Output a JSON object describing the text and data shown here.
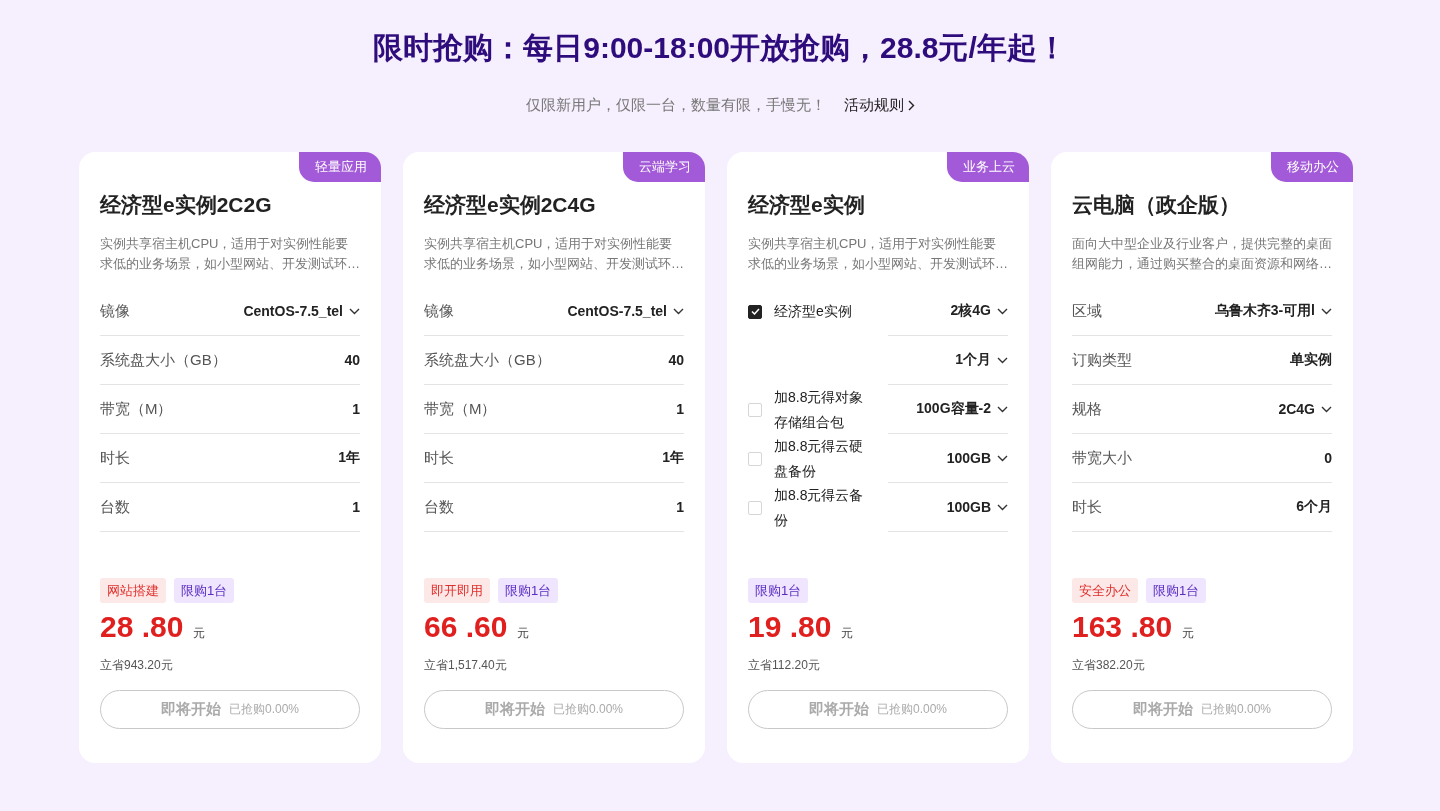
{
  "header": {
    "title": "限时抢购：每日9:00-18:00开放抢购，28.8元/年起！",
    "subtitle": "仅限新用户，仅限一台，数量有限，手慢无！",
    "rules_link": "活动规则"
  },
  "cards": [
    {
      "badge": "轻量应用",
      "title": "经济型e实例2C2G",
      "description": "实例共享宿主机CPU，适用于对实例性能要求低的业务场景，如小型网站、开发测试环…",
      "rows": [
        {
          "kind": "field",
          "label": "镜像",
          "value": "CentOS-7.5_tel",
          "dropdown": true
        },
        {
          "kind": "field",
          "label": "系统盘大小（GB）",
          "value": "40",
          "dropdown": false
        },
        {
          "kind": "field",
          "label": "带宽（M）",
          "value": "1",
          "dropdown": false
        },
        {
          "kind": "field",
          "label": "时长",
          "value": "1年",
          "dropdown": false
        },
        {
          "kind": "field",
          "label": "台数",
          "value": "1",
          "dropdown": false
        }
      ],
      "tags": [
        {
          "kind": "feature",
          "text": "网站搭建"
        },
        {
          "kind": "limit",
          "text": "限购1台"
        }
      ],
      "price": "28 .80",
      "currency": "元",
      "savings": "立省943.20元",
      "button": {
        "label": "即将开始",
        "progress": "已抢购0.00%",
        "disabled": true
      }
    },
    {
      "badge": "云端学习",
      "title": "经济型e实例2C4G",
      "description": "实例共享宿主机CPU，适用于对实例性能要求低的业务场景，如小型网站、开发测试环…",
      "rows": [
        {
          "kind": "field",
          "label": "镜像",
          "value": "CentOS-7.5_tel",
          "dropdown": true
        },
        {
          "kind": "field",
          "label": "系统盘大小（GB）",
          "value": "40",
          "dropdown": false
        },
        {
          "kind": "field",
          "label": "带宽（M）",
          "value": "1",
          "dropdown": false
        },
        {
          "kind": "field",
          "label": "时长",
          "value": "1年",
          "dropdown": false
        },
        {
          "kind": "field",
          "label": "台数",
          "value": "1",
          "dropdown": false
        }
      ],
      "tags": [
        {
          "kind": "feature",
          "text": "即开即用"
        },
        {
          "kind": "limit",
          "text": "限购1台"
        }
      ],
      "price": "66 .60",
      "currency": "元",
      "savings": "立省1,517.40元",
      "button": {
        "label": "即将开始",
        "progress": "已抢购0.00%",
        "disabled": true
      }
    },
    {
      "badge": "业务上云",
      "title": "经济型e实例",
      "description": "实例共享宿主机CPU，适用于对实例性能要求低的业务场景，如小型网站、开发测试环…",
      "rows": [
        {
          "kind": "option",
          "checked": true,
          "label": "经济型e实例",
          "value": "2核4G",
          "dropdown": true
        },
        {
          "kind": "extra",
          "value": "1个月",
          "dropdown": true
        },
        {
          "kind": "option",
          "checked": false,
          "label": "加8.8元得对象存储组合包",
          "value": "100G容量-2",
          "dropdown": true
        },
        {
          "kind": "option",
          "checked": false,
          "label": "加8.8元得云硬盘备份",
          "value": "100GB",
          "dropdown": true
        },
        {
          "kind": "option",
          "checked": false,
          "label": "加8.8元得云备份",
          "value": "100GB",
          "dropdown": true
        }
      ],
      "tags": [
        {
          "kind": "limit",
          "text": "限购1台"
        }
      ],
      "price": "19 .80",
      "currency": "元",
      "savings": "立省112.20元",
      "button": {
        "label": "即将开始",
        "progress": "已抢购0.00%",
        "disabled": true
      }
    },
    {
      "badge": "移动办公",
      "title": "云电脑（政企版）",
      "description": "面向大中型企业及行业客户，提供完整的桌面组网能力，通过购买整合的桌面资源和网络…",
      "rows": [
        {
          "kind": "field",
          "label": "区域",
          "value": "乌鲁木齐3-可用l",
          "dropdown": true
        },
        {
          "kind": "field",
          "label": "订购类型",
          "value": "单实例",
          "dropdown": false
        },
        {
          "kind": "field",
          "label": "规格",
          "value": "2C4G",
          "dropdown": true
        },
        {
          "kind": "field",
          "label": "带宽大小",
          "value": "0",
          "dropdown": false
        },
        {
          "kind": "field",
          "label": "时长",
          "value": "6个月",
          "dropdown": false
        }
      ],
      "tags": [
        {
          "kind": "feature",
          "text": "安全办公"
        },
        {
          "kind": "limit",
          "text": "限购1台"
        }
      ],
      "price": "163 .80",
      "currency": "元",
      "savings": "立省382.20元",
      "button": {
        "label": "即将开始",
        "progress": "已抢购0.00%",
        "disabled": true
      }
    }
  ]
}
